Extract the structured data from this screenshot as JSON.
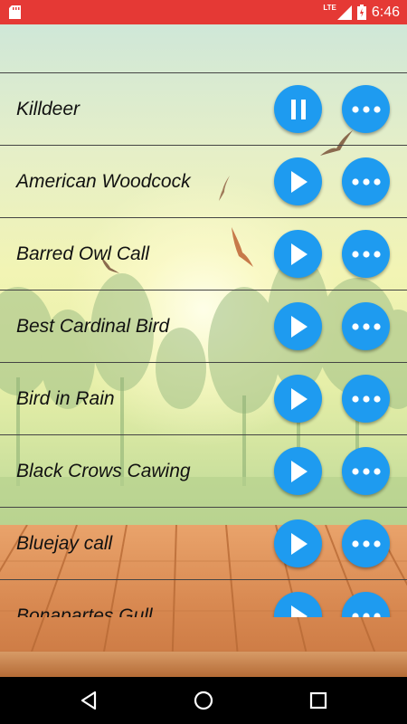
{
  "status_bar": {
    "time": "6:46",
    "network": "LTE"
  },
  "songs": [
    {
      "title": "Killdeer",
      "playing": true
    },
    {
      "title": "American Woodcock",
      "playing": false
    },
    {
      "title": "Barred Owl Call",
      "playing": false
    },
    {
      "title": "Best Cardinal Bird",
      "playing": false
    },
    {
      "title": "Bird in Rain",
      "playing": false
    },
    {
      "title": "Black Crows Cawing",
      "playing": false
    },
    {
      "title": "Bluejay call",
      "playing": false
    },
    {
      "title": "Bonapartes Gull",
      "playing": false
    }
  ],
  "colors": {
    "status_bar": "#e53935",
    "button": "#1e9bf0"
  },
  "icons": {
    "play": "play-icon",
    "pause": "pause-icon",
    "more": "more-horizontal-icon"
  }
}
